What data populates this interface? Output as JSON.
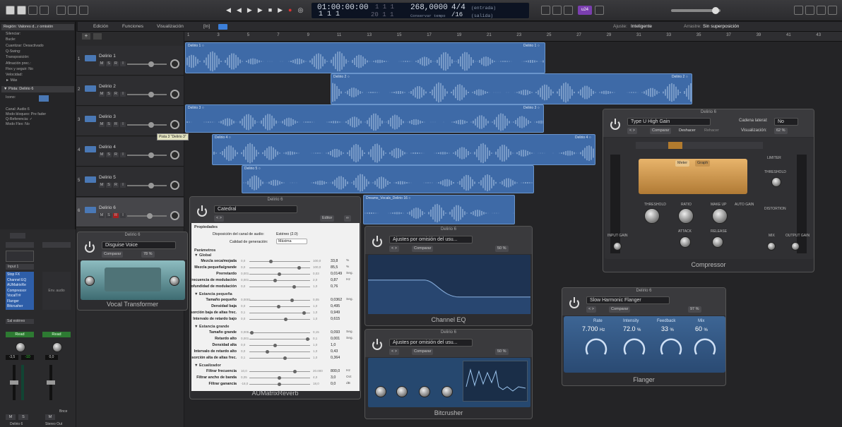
{
  "control_bar": {
    "lcd_time": "01:00:00:00",
    "lcd_bars": "1  1  1",
    "lcd_beats": "1 1 1",
    "lcd_beats2": "20 1 1",
    "lcd_tempo": "268,0000",
    "lcd_sig": "4/4",
    "lcd_div": "/16",
    "lcd_in": "(entrada)",
    "lcd_out": "(salida)",
    "lcd_keep": "Conservar tempo",
    "cpu_label": "u24"
  },
  "secondary_bar": {
    "edit": "Edición",
    "functions": "Funciones",
    "view": "Visualización",
    "in": "[In]",
    "snap_label": "Ajuste:",
    "snap_value": "Inteligente",
    "drag_label": "Arrastre:",
    "drag_value": "Sin superposición"
  },
  "ruler": [
    "1",
    "3",
    "5",
    "7",
    "9",
    "11",
    "13",
    "15",
    "17",
    "19",
    "21",
    "23",
    "25",
    "27",
    "29",
    "31",
    "33",
    "35",
    "37",
    "39",
    "41",
    "43"
  ],
  "inspector": {
    "region_header": "Región: Valores d...r omisión",
    "rows": [
      "Silenciar:",
      "Bucle:",
      "Cuantizar: Desactivado",
      "Q-Swing:",
      "Transposición:",
      "Afinación prec.:",
      "Flex y seguir: No",
      "Velocidad:",
      "► Más"
    ],
    "track_header": "▼ Pista: Delirio 6",
    "track_rows": [
      "Icono:",
      "Canal: Audio 6",
      "Modo bloqueo: Pre fader",
      "Q-Referencia: ✓",
      "Modo Flex: No"
    ]
  },
  "tracks": [
    {
      "num": "1",
      "name": "Delirio 1"
    },
    {
      "num": "2",
      "name": "Delirio 2"
    },
    {
      "num": "3",
      "name": "Delirio 3"
    },
    {
      "num": "4",
      "name": "Delirio 4"
    },
    {
      "num": "5",
      "name": "Delirio 5"
    },
    {
      "num": "6",
      "name": "Delirio 6"
    }
  ],
  "track_buttons": {
    "m": "M",
    "s": "S",
    "r": "R",
    "i": "I"
  },
  "tooltip": "Pista 3 \"Delirio 3\"",
  "regions": [
    {
      "name": "Delirio 1 ○",
      "name2": "Delirio 1 ○"
    },
    {
      "name": "Delirio 2 ○",
      "name2": "Delirio 2 ○"
    },
    {
      "name": "Delirio 3 ○",
      "name2": "Delirio 3 ○"
    },
    {
      "name": "Delirio 4 ○",
      "name2": "Delirio 4 ○"
    },
    {
      "name": "Delirio 5 ○"
    },
    {
      "name": "Dreams_Vocals_Delirio 16 ○"
    }
  ],
  "vocal_transformer": {
    "title": "Delirio 6",
    "preset": "Disguise Voice",
    "compare": "Comparar",
    "pct": "78 %",
    "name": "Vocal Transformer"
  },
  "reverb": {
    "title": "Delirio 6",
    "preset": "Catedral",
    "editor": "Editor",
    "name": "AUMatrixReverb",
    "props": "Propiedades",
    "disp_label": "Disposición del canal de audio:",
    "disp_value": "Estéreo (2.0)",
    "quality_label": "Calidad de generación:",
    "quality_value": "Máxima",
    "params": "Parámetros",
    "sections": [
      {
        "title": "▼ Global",
        "rows": [
          {
            "label": "Mezcla seca/mojada",
            "min": "0,0",
            "max": "100,0",
            "value": "33,8",
            "unit": "%"
          },
          {
            "label": "Mezcla pequeña/grande",
            "min": "0,0",
            "max": "100,0",
            "value": "85,5",
            "unit": "%"
          },
          {
            "label": "Prerretardo",
            "min": "0,001",
            "max": "0,03",
            "value": "0,0149",
            "unit": "Seg."
          },
          {
            "label": "Frecuencia de modulación",
            "min": "0,001",
            "max": "2,0",
            "value": "0,87",
            "unit": "Hz"
          },
          {
            "label": "Profundidad de modulación",
            "min": "0,0",
            "max": "1,0",
            "value": "0,76",
            "unit": ""
          }
        ]
      },
      {
        "title": "▼ Estancia pequeña",
        "rows": [
          {
            "label": "Tamaño pequeño",
            "min": "0,0001",
            "max": "0,05",
            "value": "0,0362",
            "unit": "Seg."
          },
          {
            "label": "Densidad baja",
            "min": "0,0",
            "max": "1,0",
            "value": "0,495",
            "unit": ""
          },
          {
            "label": "Absorción baja de altas frec.",
            "min": "0,1",
            "max": "1,0",
            "value": "0,949",
            "unit": ""
          },
          {
            "label": "Intervalo de retardo bajo",
            "min": "0,0",
            "max": "1,0",
            "value": "0,615",
            "unit": ""
          }
        ]
      },
      {
        "title": "▼ Estancia grande",
        "rows": [
          {
            "label": "Tamaño grande",
            "min": "0,005",
            "max": "0,15",
            "value": "0,093",
            "unit": "Seg."
          },
          {
            "label": "Retardo alto",
            "min": "0,001",
            "max": "0,1",
            "value": "0,001",
            "unit": "Seg."
          },
          {
            "label": "Densidad alta",
            "min": "0,0",
            "max": "1,0",
            "value": "1,0",
            "unit": ""
          },
          {
            "label": "Intervalo de retardo alto",
            "min": "0,0",
            "max": "1,0",
            "value": "0,43",
            "unit": ""
          },
          {
            "label": "Absorción alta de altas frec.",
            "min": "0,1",
            "max": "1,0",
            "value": "0,364",
            "unit": ""
          }
        ]
      },
      {
        "title": "▼ Ecualizador",
        "rows": [
          {
            "label": "Filtrar frecuencia",
            "min": "10,0",
            "max": "20.000",
            "value": "800,0",
            "unit": "Hz"
          },
          {
            "label": "Filtrar ancho de banda",
            "min": "0,05",
            "max": "4,0",
            "value": "3,0",
            "unit": "Oct"
          },
          {
            "label": "Filtrar ganancia",
            "min": "-18,0",
            "max": "18,0",
            "value": "0,0",
            "unit": "dB"
          }
        ]
      }
    ]
  },
  "channel_eq": {
    "title": "Delirio 6",
    "preset": "Ajustes por omisión del usu...",
    "compare": "Comparar",
    "pct": "50 %",
    "name": "Channel EQ"
  },
  "bitcrusher": {
    "title": "Delirio 6",
    "preset": "Ajustes por omisión del usu...",
    "compare": "Comparar",
    "pct": "50 %",
    "name": "Bitcrusher"
  },
  "compressor": {
    "title": "Delirio 6",
    "preset": "Type U High Gain",
    "compare": "Comparar",
    "undo": "Deshacer",
    "redo": "Rehacer",
    "sidechain_label": "Cadena lateral:",
    "sidechain_value": "No",
    "view_label": "Visualización:",
    "view_value": "62 %",
    "meter_tab": "Meter",
    "graph_tab": "Graph",
    "limiter": "LIMITER",
    "threshold": "THRESHOLD",
    "ratio": "RATIO",
    "makeup": "MAKE UP",
    "autogain": "AUTO GAIN",
    "attack": "ATTACK",
    "release": "RELEASE",
    "distortion": "DISTORTION",
    "input_gain": "INPUT GAIN",
    "mix": "MIX",
    "output_gain": "OUTPUT GAIN",
    "name": "Compressor"
  },
  "flanger": {
    "title": "Delirio 6",
    "preset": "Slow Harmonic Flanger",
    "compare": "Comparar",
    "pct": "97 %",
    "rate_label": "Rate",
    "rate_value": "7.700",
    "rate_unit": "Hz",
    "intensity_label": "Intensity",
    "intensity_value": "72.0",
    "intensity_unit": "%",
    "feedback_label": "Feedback",
    "feedback_value": "33",
    "feedback_unit": "%",
    "mix_label": "Mix",
    "mix_value": "60",
    "mix_unit": "%",
    "name": "Flanger"
  },
  "strips": {
    "read": "Read",
    "read2": "Read",
    "input": "Input 1",
    "plugins": [
      "Stop FX",
      "Channel EQ",
      "AUMatrixRe",
      "Compressor",
      "VocalTr#",
      "Flanger",
      "Bitcrusher"
    ],
    "eq": "Sal estéreo",
    "val1": "-3,5",
    "val2": "-10",
    "val3": "0,0",
    "bnce": "Bnce",
    "name1": "Delirio 6",
    "name2": "Stereo Out",
    "m": "M",
    "s": "S"
  }
}
